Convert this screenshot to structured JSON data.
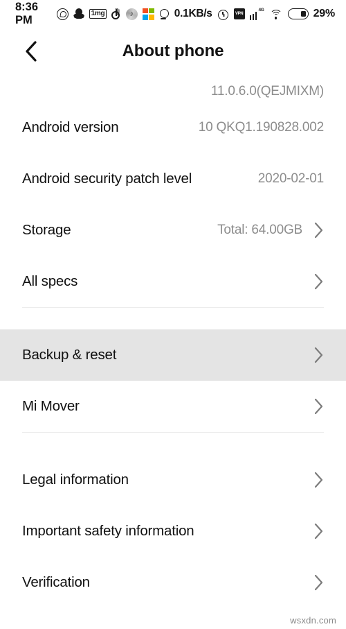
{
  "status_bar": {
    "clock": "8:36 PM",
    "network_speed": "0.1KB/s",
    "battery_percent": "29%",
    "signal_label": "4G",
    "icons": [
      "whatsapp-icon",
      "snapchat-icon",
      "onemg-icon",
      "tiktok-icon",
      "music-icon",
      "microsoft-store-icon",
      "location-icon",
      "alarm-icon",
      "vpn-icon",
      "signal-icon",
      "wifi-icon",
      "battery-icon"
    ],
    "onemg_label": "1mg",
    "vpn_label": "VPN"
  },
  "header": {
    "title": "About phone",
    "back_icon": "chevron-left-icon"
  },
  "list": {
    "clipped_top_row": {
      "label": "",
      "value": "11.0.6.0(QEJMIXM)"
    },
    "groups": [
      {
        "rows": [
          {
            "label": "Android version",
            "value": "10 QKQ1.190828.002",
            "chevron": false,
            "pressed": false
          },
          {
            "label": "Android security patch level",
            "value": "2020-02-01",
            "chevron": false,
            "pressed": false
          },
          {
            "label": "Storage",
            "value": "Total: 64.00GB",
            "chevron": true,
            "pressed": false
          },
          {
            "label": "All specs",
            "value": "",
            "chevron": true,
            "pressed": false
          }
        ]
      },
      {
        "rows": [
          {
            "label": "Backup & reset",
            "value": "",
            "chevron": true,
            "pressed": true
          },
          {
            "label": "Mi Mover",
            "value": "",
            "chevron": true,
            "pressed": false
          }
        ]
      },
      {
        "rows": [
          {
            "label": "Legal information",
            "value": "",
            "chevron": true,
            "pressed": false
          },
          {
            "label": "Important safety information",
            "value": "",
            "chevron": true,
            "pressed": false
          },
          {
            "label": "Verification",
            "value": "",
            "chevron": true,
            "pressed": false
          }
        ]
      }
    ]
  },
  "watermark": "wsxdn.com",
  "colors": {
    "background": "#ffffff",
    "pressed_row": "#e4e4e4",
    "primary_text": "#111111",
    "secondary_text": "#8d8d8d",
    "divider": "#ececec",
    "chevron": "#7c7c7c"
  }
}
